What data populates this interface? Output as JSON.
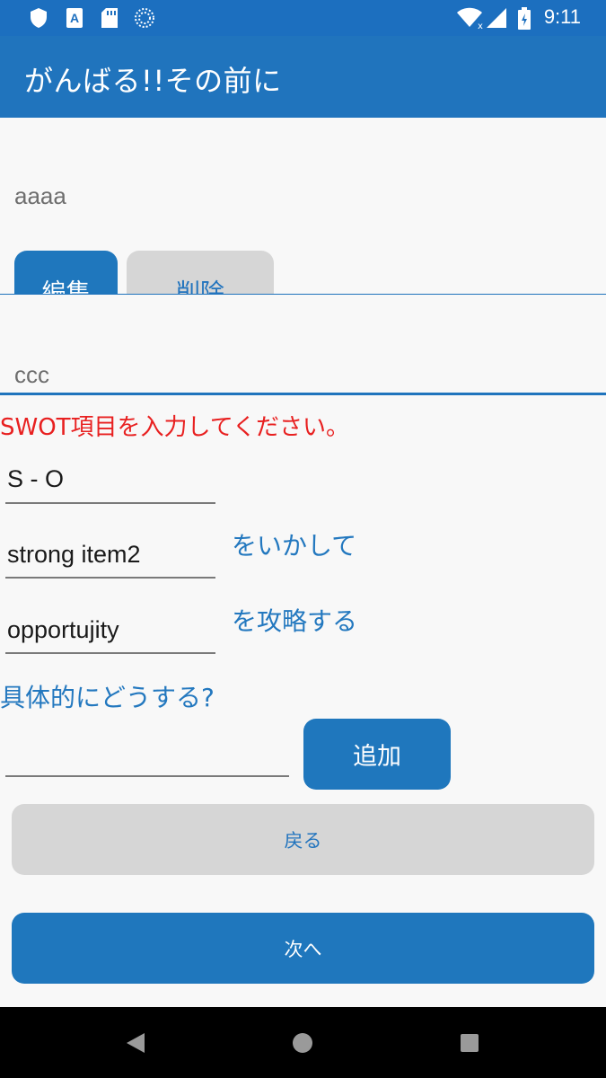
{
  "status_bar": {
    "time": "9:11",
    "left_icons": [
      "shield-icon",
      "font-a-icon",
      "sd-card-icon",
      "sync-icon"
    ],
    "right_icons": [
      "wifi-icon",
      "signal-icon",
      "battery-icon"
    ]
  },
  "app_bar": {
    "title": "がんばる!!その前に"
  },
  "list": {
    "item1_text": "aaaa",
    "edit_label": "編集",
    "delete_label": "削除",
    "item2_text": "ccc"
  },
  "form": {
    "instruction": "SWOT項目を入力してください。",
    "type_value": "S - O",
    "strength_value": "strong item2",
    "strength_suffix": "をいかして",
    "opportunity_value": "opportujity",
    "opportunity_suffix": "を攻略する",
    "question": "具体的にどうする?",
    "action_value": "",
    "add_label": "追加"
  },
  "buttons": {
    "back_label": "戻る",
    "next_label": "次へ"
  },
  "colors": {
    "primary": "#2074bd",
    "status_bar": "#1c6fbf",
    "error_text": "#e82020",
    "gray_button": "#d6d6d6"
  }
}
